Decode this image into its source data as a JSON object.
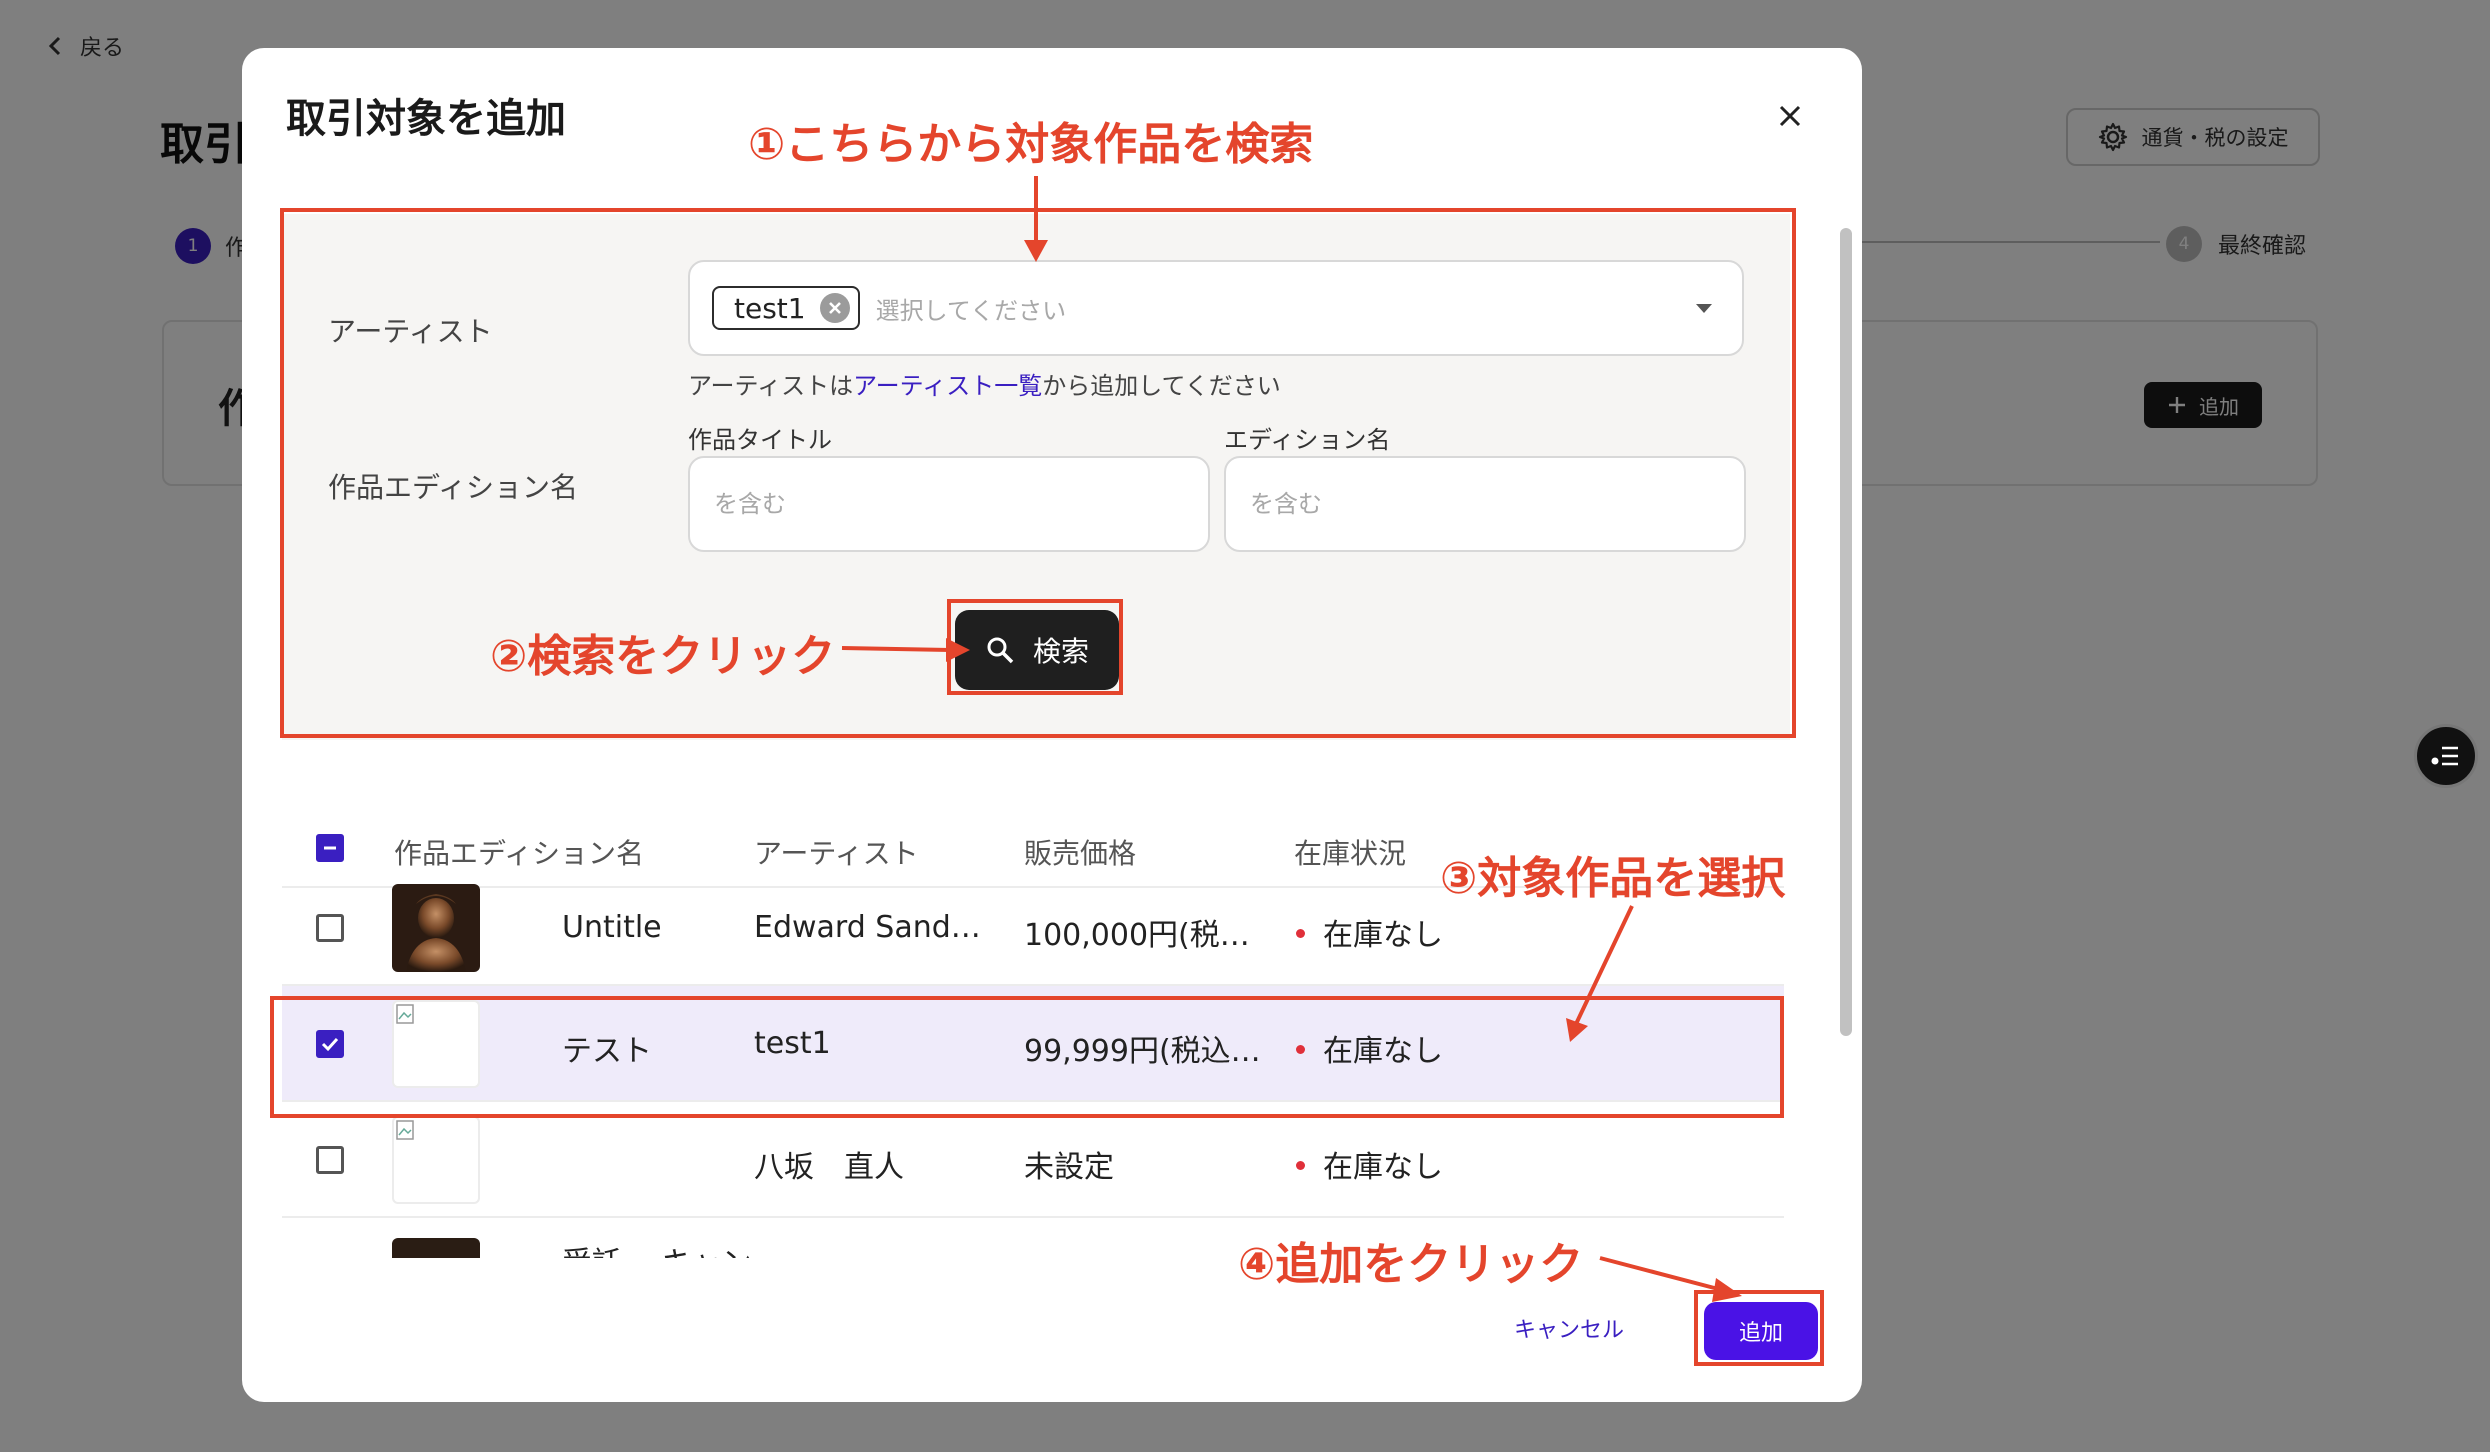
{
  "background": {
    "back_label": "戻る",
    "title": "取引",
    "currency_button": "通貨・税の設定",
    "steps": [
      {
        "number": "1",
        "label": "作"
      },
      {
        "number": "4",
        "label": "最終確認"
      }
    ],
    "card_title": "作",
    "add_button": "追加"
  },
  "modal": {
    "title": "取引対象を追加",
    "search": {
      "artist_label": "アーティスト",
      "artist_chip": "test1",
      "artist_placeholder": "選択してください",
      "help_prefix": "アーティストは",
      "help_link": "アーティスト一覧",
      "help_suffix": "から追加してください",
      "edition_section_label": "作品エディション名",
      "work_title_label": "作品タイトル",
      "work_title_placeholder": "を含む",
      "edition_name_label": "エディション名",
      "edition_name_placeholder": "を含む",
      "search_button": "検索"
    },
    "table": {
      "headers": [
        "作品エディション名",
        "アーティスト",
        "販売価格",
        "在庫状況"
      ],
      "rows": [
        {
          "title": "Untitle",
          "artist": "Edward Sand…",
          "price": "100,000円(税…",
          "stock": "在庫なし",
          "checked": false
        },
        {
          "title": "テスト",
          "artist": "test1",
          "price": "99,999円(税込…",
          "stock": "在庫なし",
          "checked": true
        },
        {
          "title": "",
          "artist": "八坂　直人",
          "price": "未設定",
          "stock": "在庫なし",
          "checked": false
        }
      ],
      "partial_row_title": "受託 ・キャン"
    },
    "cancel_button": "キャンセル",
    "add_button": "追加"
  },
  "annotations": {
    "step1": "①こちらから対象作品を検索",
    "step2": "②検索をクリック",
    "step3": "③対象作品を選択",
    "step4": "④追加をクリック"
  },
  "colors": {
    "accent": "#3a1fc1",
    "add_button": "#4a12e6",
    "annotation": "#e4452c",
    "stock_dot": "#e0303a"
  }
}
